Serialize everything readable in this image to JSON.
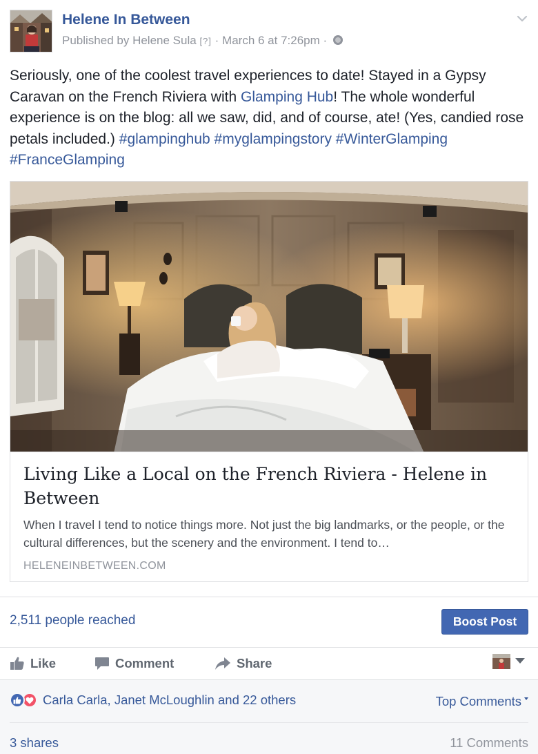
{
  "post": {
    "page_name": "Helene In Between",
    "published_prefix": "Published by",
    "author": "Helene Sula",
    "author_tag": "[?]",
    "separator": "·",
    "timestamp": "March 6 at 7:26pm",
    "text_part1": "Seriously, one of the coolest travel experiences to date! Stayed in a Gypsy Caravan on the French Riviera with ",
    "mention": "Glamping Hub",
    "text_part2": "! The whole wonderful experience is on the blog: all we saw, did, and of course, ate! (Yes, candied rose petals included.) ",
    "hashtags": [
      "#glampinghub",
      "#myglampingstory",
      "#WinterGlamping",
      "#FranceGlamping"
    ]
  },
  "share": {
    "title": "Living Like a Local on the French Riviera - Helene in Between",
    "description": "When I travel I tend to notice things more. Not just the big landmarks, or the people, or the cultural differences, but the scenery and the environment. I tend to…",
    "domain": "HELENEINBETWEEN.COM"
  },
  "insights": {
    "reached": "2,511 people reached",
    "boost_label": "Boost Post"
  },
  "actions": {
    "like": "Like",
    "comment": "Comment",
    "share": "Share"
  },
  "feedback": {
    "reactors": "Carla Carla, Janet McLoughlin and 22 others",
    "top_comments": "Top Comments",
    "shares": "3 shares",
    "comments": "11 Comments"
  },
  "colors": {
    "link": "#365899",
    "boost": "#4267b2",
    "like_reaction": "#4267b2",
    "love_reaction": "#f25268"
  },
  "icons": {
    "like": "thumbs-up-icon",
    "comment": "speech-bubble-icon",
    "share": "share-arrow-icon",
    "privacy": "globe-icon",
    "menu": "chevron-down-icon"
  }
}
